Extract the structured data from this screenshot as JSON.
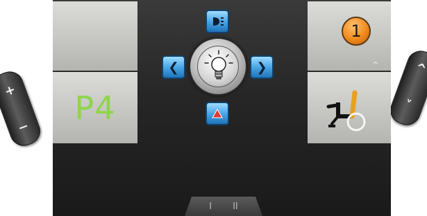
{
  "left_paddle": {
    "plus": "+",
    "minus": "−"
  },
  "right_paddle": {
    "up": "^",
    "down": "˅"
  },
  "profile": {
    "label": "P4"
  },
  "speed": {
    "value": "1"
  },
  "page_indicator": {
    "page_1": "I",
    "page_2": "II"
  },
  "colors": {
    "profile_text": "#8fd44c",
    "speed_badge": "#f08a1c",
    "dpad_blue": "#4aa6e6",
    "hazard_red": "#e03a2e",
    "seat_accent": "#e8a020"
  },
  "icons": {
    "dpad_up": "headlight-icon",
    "dpad_left": "left-indicator-icon",
    "dpad_right": "right-indicator-icon",
    "dpad_down": "hazard-icon",
    "center": "light-bulb-icon",
    "bottom_right_panel": "wheelchair-seat-icon"
  }
}
